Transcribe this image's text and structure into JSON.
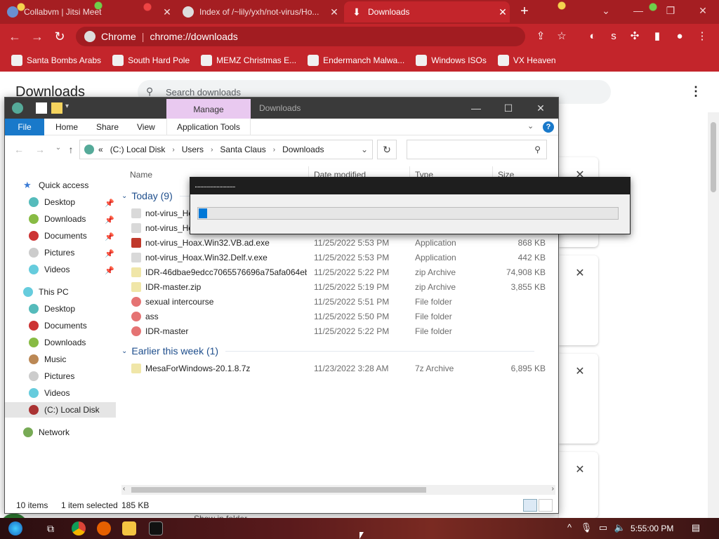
{
  "colors": {
    "tabstrip": "#a51e22",
    "accent": "#c3252b",
    "file_tab": "#1979ca",
    "manage_tab": "#e9c9f0",
    "progress": "#0078d7",
    "group_text": "#1e4e8c"
  },
  "chrome": {
    "tabs": [
      {
        "title": "Collabvm | Jitsi Meet",
        "close": "✕",
        "icon": "jitsi-icon"
      },
      {
        "title": "Index of /~lily/yxh/not-virus/Ho...",
        "close": "✕",
        "icon": "globe-icon"
      },
      {
        "title": "Downloads",
        "close": "✕",
        "icon": "download-icon"
      }
    ],
    "new_tab": "+",
    "window_controls": {
      "menu": "⌄",
      "minimize": "—",
      "restore": "❐",
      "close": "✕"
    },
    "omnibox": {
      "site": "Chrome",
      "url": "chrome://downloads"
    },
    "bookmarks": [
      {
        "label": "Santa Bombs Arabs",
        "icon": "person-icon"
      },
      {
        "label": "South Hard Pole",
        "icon": "person-icon"
      },
      {
        "label": "MEMZ Christmas E...",
        "icon": "page-icon"
      },
      {
        "label": "Endermanch Malwa...",
        "icon": "skull-icon"
      },
      {
        "label": "Windows ISOs",
        "icon": "person-icon"
      },
      {
        "label": "VX Heaven",
        "icon": "skull-icon"
      }
    ]
  },
  "downloads_page": {
    "title": "Downloads",
    "search_placeholder": "Search downloads",
    "more_menu": "⋮",
    "item_close": "✕",
    "partial_text": "Show in folder"
  },
  "explorer": {
    "manage_tab": "Manage",
    "window_title": "Downloads",
    "window_controls": {
      "minimize": "—",
      "maximize": "☐",
      "close": "✕"
    },
    "ribbon_tabs": [
      "File",
      "Home",
      "Share",
      "View",
      "Application Tools"
    ],
    "help": "?",
    "address": {
      "prefix": "«",
      "crumbs": [
        "(C:) Local Disk",
        "Users",
        "Santa Claus",
        "Downloads"
      ],
      "refresh": "↻"
    },
    "nav": {
      "quick_access": "Quick access",
      "quick_items": [
        "Desktop",
        "Downloads",
        "Documents",
        "Pictures",
        "Videos"
      ],
      "this_pc": "This PC",
      "pc_items": [
        "Desktop",
        "Documents",
        "Downloads",
        "Music",
        "Pictures",
        "Videos",
        "(C:) Local Disk"
      ],
      "network": "Network"
    },
    "columns": {
      "name": "Name",
      "date": "Date modified",
      "type": "Type",
      "size": "Size"
    },
    "groups": [
      {
        "label": "Today (9)",
        "rows": [
          {
            "name": "not-virus_Hoax.Win32.MEMZ.ad.exe",
            "date": "",
            "type": "",
            "size": "",
            "icon": "app-icon"
          },
          {
            "name": "not-virus_Hoax.Win32.CP.exe",
            "date": "",
            "type": "",
            "size": "",
            "icon": "app-icon"
          },
          {
            "name": "not-virus_Hoax.Win32.VB.ad.exe",
            "date": "11/25/2022 5:53 PM",
            "type": "Application",
            "size": "868 KB",
            "icon": "red-x-icon"
          },
          {
            "name": "not-virus_Hoax.Win32.Delf.v.exe",
            "date": "11/25/2022 5:53 PM",
            "type": "Application",
            "size": "442 KB",
            "icon": "app-icon"
          },
          {
            "name": "IDR-46dbae9edcc7065576696a75afa064eb...",
            "date": "11/25/2022 5:22 PM",
            "type": "zip Archive",
            "size": "74,908 KB",
            "icon": "zip-icon"
          },
          {
            "name": "IDR-master.zip",
            "date": "11/25/2022 5:19 PM",
            "type": "zip Archive",
            "size": "3,855 KB",
            "icon": "zip-icon"
          },
          {
            "name": "sexual intercourse",
            "date": "11/25/2022 5:51 PM",
            "type": "File folder",
            "size": "",
            "icon": "folder-icon"
          },
          {
            "name": "ass",
            "date": "11/25/2022 5:50 PM",
            "type": "File folder",
            "size": "",
            "icon": "folder-icon"
          },
          {
            "name": "IDR-master",
            "date": "11/25/2022 5:22 PM",
            "type": "File folder",
            "size": "",
            "icon": "folder-icon"
          }
        ]
      },
      {
        "label": "Earlier this week (1)",
        "rows": [
          {
            "name": "MesaForWindows-20.1.8.7z",
            "date": "11/23/2022 3:28 AM",
            "type": "7z Archive",
            "size": "6,895 KB",
            "icon": "zip-icon"
          }
        ]
      }
    ],
    "status": {
      "count": "10 items",
      "selected": "1 item selected",
      "size": "185 KB"
    }
  },
  "progress_dialog": {
    "title": "............................",
    "progress": 0.02
  },
  "taskbar": {
    "time": "5:55:00 PM"
  }
}
